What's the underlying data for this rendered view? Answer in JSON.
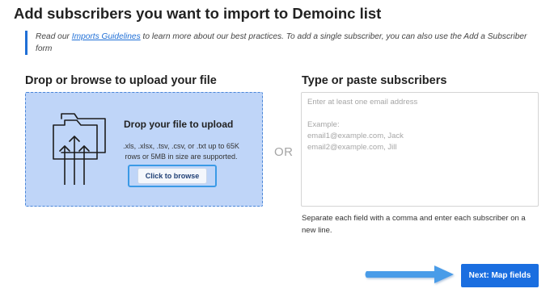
{
  "page": {
    "title": "Add subscribers you want to import to Demoinc list"
  },
  "guidelines": {
    "prefix": "Read our ",
    "link_text": "Imports Guidelines",
    "suffix": " to learn more about our best practices. To add a single subscriber, you can also use the Add a Subscriber form"
  },
  "upload": {
    "heading": "Drop or browse to upload your file",
    "drop_title": "Drop your file to upload",
    "hint": ".xls, .xlsx, .tsv, .csv, or .txt up to 65K rows or 5MB in size are supported.",
    "browse_label": "Click to browse",
    "icon": "folder-upload-icon"
  },
  "divider": {
    "or_label": "OR"
  },
  "paste": {
    "heading": "Type or paste subscribers",
    "placeholder": "Enter at least one email address\n\nExample:\nemail1@example.com, Jack\nemail2@example.com, Jill",
    "value": "",
    "help": "Separate each field with a comma and enter each subscriber on a new line."
  },
  "footer": {
    "next_label": "Next: Map fields",
    "arrow_icon": "right-arrow-icon"
  },
  "colors": {
    "accent": "#1a6ee0",
    "dropzone_bg": "#bfd5f8",
    "highlight": "#3b9ae6",
    "arrow": "#4a9ce8"
  }
}
